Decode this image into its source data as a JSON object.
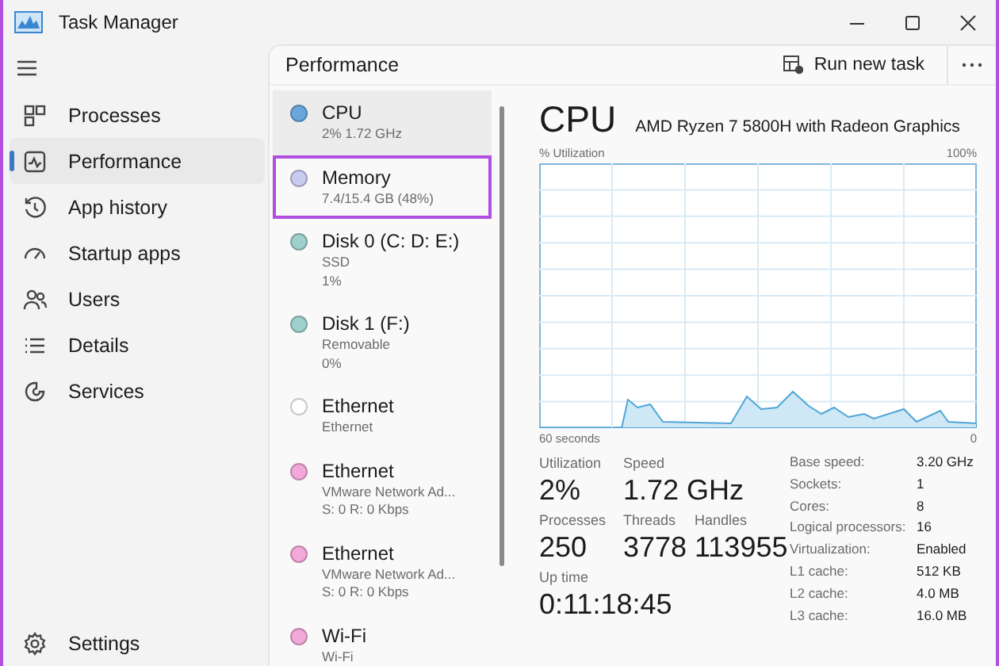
{
  "window": {
    "title": "Task Manager"
  },
  "nav": {
    "items": [
      {
        "label": "Processes",
        "selected": false
      },
      {
        "label": "Performance",
        "selected": true
      },
      {
        "label": "App history",
        "selected": false
      },
      {
        "label": "Startup apps",
        "selected": false
      },
      {
        "label": "Users",
        "selected": false
      },
      {
        "label": "Details",
        "selected": false
      },
      {
        "label": "Services",
        "selected": false
      }
    ],
    "settings": {
      "label": "Settings"
    }
  },
  "header": {
    "title": "Performance",
    "run_task": "Run new task"
  },
  "devices": [
    {
      "name": "CPU",
      "lines": [
        "2%  1.72 GHz"
      ],
      "color": "#6aa6dd",
      "selected": true,
      "highlighted": false
    },
    {
      "name": "Memory",
      "lines": [
        "7.4/15.4 GB (48%)"
      ],
      "color": "#c9ccf0",
      "selected": false,
      "highlighted": true
    },
    {
      "name": "Disk 0 (C: D: E:)",
      "lines": [
        "SSD",
        "1%"
      ],
      "color": "#9fd0cc",
      "selected": false,
      "highlighted": false
    },
    {
      "name": "Disk 1 (F:)",
      "lines": [
        "Removable",
        "0%"
      ],
      "color": "#9fd0cc",
      "selected": false,
      "highlighted": false
    },
    {
      "name": "Ethernet",
      "lines": [
        "Ethernet"
      ],
      "color": "#ffffff",
      "selected": false,
      "highlighted": false
    },
    {
      "name": "Ethernet",
      "lines": [
        "VMware Network Ad...",
        "S: 0 R: 0 Kbps"
      ],
      "color": "#f2a9d9",
      "selected": false,
      "highlighted": false
    },
    {
      "name": "Ethernet",
      "lines": [
        "VMware Network Ad...",
        "S: 0 R: 0 Kbps"
      ],
      "color": "#f2a9d9",
      "selected": false,
      "highlighted": false
    },
    {
      "name": "Wi-Fi",
      "lines": [
        "Wi-Fi"
      ],
      "color": "#f2a9d9",
      "selected": false,
      "highlighted": false
    }
  ],
  "detail": {
    "title": "CPU",
    "model": "AMD Ryzen 7 5800H with Radeon Graphics",
    "graph": {
      "y_label": "% Utilization",
      "y_max": "100%",
      "x_label": "60 seconds",
      "x_end": "0"
    },
    "stat_rows": [
      [
        {
          "label": "Utilization",
          "value": "2%"
        },
        {
          "label": "Speed",
          "value": "1.72 GHz"
        }
      ],
      [
        {
          "label": "Processes",
          "value": "250"
        },
        {
          "label": "Threads",
          "value": "3778"
        },
        {
          "label": "Handles",
          "value": "113955"
        }
      ],
      [
        {
          "label": "Up time",
          "value": "0:11:18:45"
        }
      ]
    ],
    "specs": [
      {
        "label": "Base speed:",
        "value": "3.20 GHz"
      },
      {
        "label": "Sockets:",
        "value": "1"
      },
      {
        "label": "Cores:",
        "value": "8"
      },
      {
        "label": "Logical processors:",
        "value": "16"
      },
      {
        "label": "Virtualization:",
        "value": "Enabled"
      },
      {
        "label": "L1 cache:",
        "value": "512 KB"
      },
      {
        "label": "L2 cache:",
        "value": "4.0 MB"
      },
      {
        "label": "L3 cache:",
        "value": "16.0 MB"
      }
    ]
  }
}
